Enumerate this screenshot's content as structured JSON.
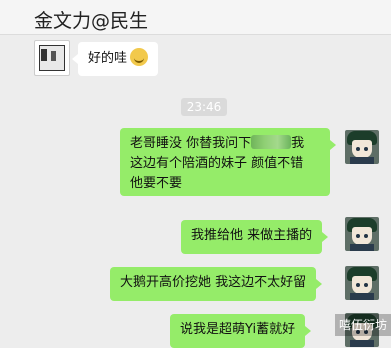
{
  "header": {
    "title": "金文力@民生"
  },
  "messages": {
    "m1": {
      "text": "好的哇"
    },
    "timestamp": "23:46",
    "m2": {
      "line1_a": "老哥睡没 你替我问下",
      "line1_b": "我",
      "line2": "这边有个陪酒的妹子 颜值不错",
      "line3": "他要不要"
    },
    "m3": {
      "text": "我推给他 来做主播的"
    },
    "m4": {
      "text": "大鹅开高价挖她 我这边不太好留"
    },
    "m5": {
      "text": "说我是超萌Yi蓄就好"
    }
  },
  "watermark": {
    "text": "嘻伍衍坊"
  },
  "icons": {
    "left_avatar": "avatar-icon",
    "right_avatar": "avatar-icon",
    "emoji": "smile-emoji-icon"
  },
  "colors": {
    "background": "#ededed",
    "outgoing_bubble": "#95ec69",
    "incoming_bubble": "#ffffff",
    "timestamp_bg": "#dadada"
  }
}
